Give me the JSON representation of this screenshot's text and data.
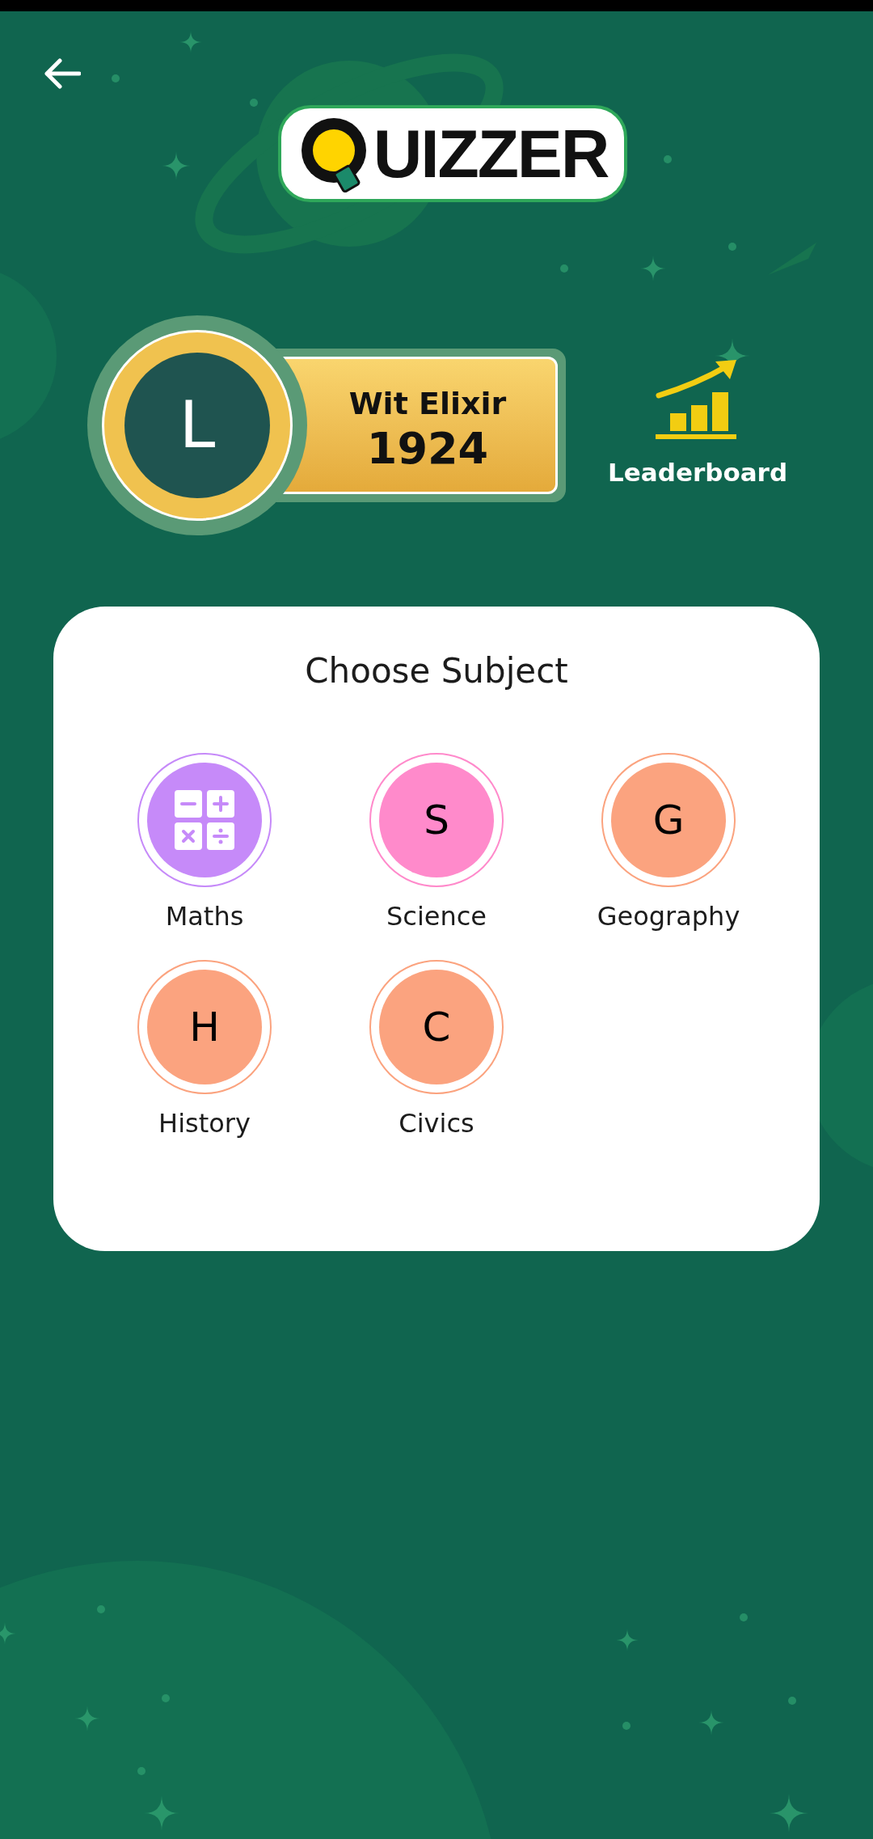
{
  "app": {
    "logo": "UIZZER"
  },
  "profile": {
    "avatar_letter": "L",
    "name": "Wit Elixir",
    "score": "1924"
  },
  "leaderboard": {
    "label": "Leaderboard"
  },
  "subjects_panel": {
    "title": "Choose Subject",
    "subjects": [
      {
        "name": "Maths",
        "kind": "icon",
        "color": "#c68af9"
      },
      {
        "name": "Science",
        "kind": "letter",
        "letter": "S",
        "color": "#ff8acb"
      },
      {
        "name": "Geography",
        "kind": "letter",
        "letter": "G",
        "color": "#fba37f"
      },
      {
        "name": "History",
        "kind": "letter",
        "letter": "H",
        "color": "#fba37f"
      },
      {
        "name": "Civics",
        "kind": "letter",
        "letter": "C",
        "color": "#fba37f"
      }
    ]
  }
}
